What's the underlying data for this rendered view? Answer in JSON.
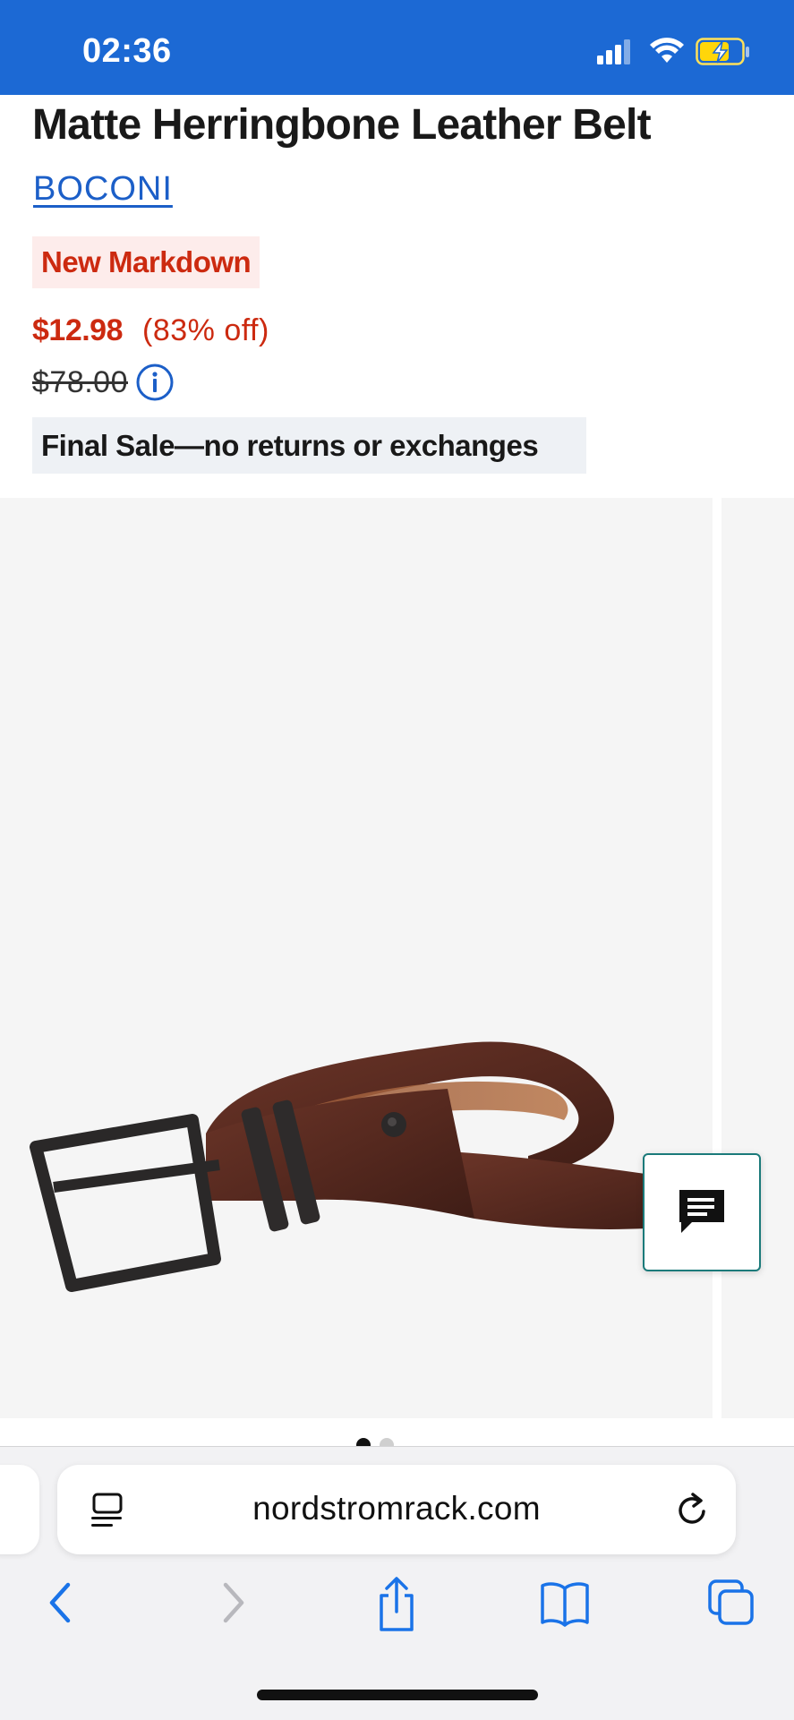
{
  "status_bar": {
    "time": "02:36"
  },
  "product": {
    "title": "Matte Herringbone Leather Belt",
    "brand": "BOCONI",
    "badge": "New Markdown",
    "sale_price": "$12.98",
    "discount": "(83% off)",
    "original_price": "$78.00",
    "final_sale_notice": "Final Sale—no returns or exchanges"
  },
  "carousel": {
    "slide_count": 2,
    "active_slide": 1
  },
  "browser": {
    "url": "nordstromrack.com"
  },
  "icons": {
    "status": [
      "signal-icon",
      "wifi-icon",
      "battery-charging-icon"
    ],
    "price_info": "info-icon",
    "chat": "chat-icon",
    "address_bar": [
      "page-menu-icon",
      "reload-icon"
    ],
    "toolbar": [
      "back-icon",
      "forward-icon",
      "share-icon",
      "bookmarks-icon",
      "tabs-icon"
    ]
  },
  "colors": {
    "status_bar": "#1c69d4",
    "sale_red": "#cc2a10",
    "brand_link": "#1c5fc8",
    "safari_blue": "#1a73e8",
    "chat_border": "#1b7a7a"
  }
}
